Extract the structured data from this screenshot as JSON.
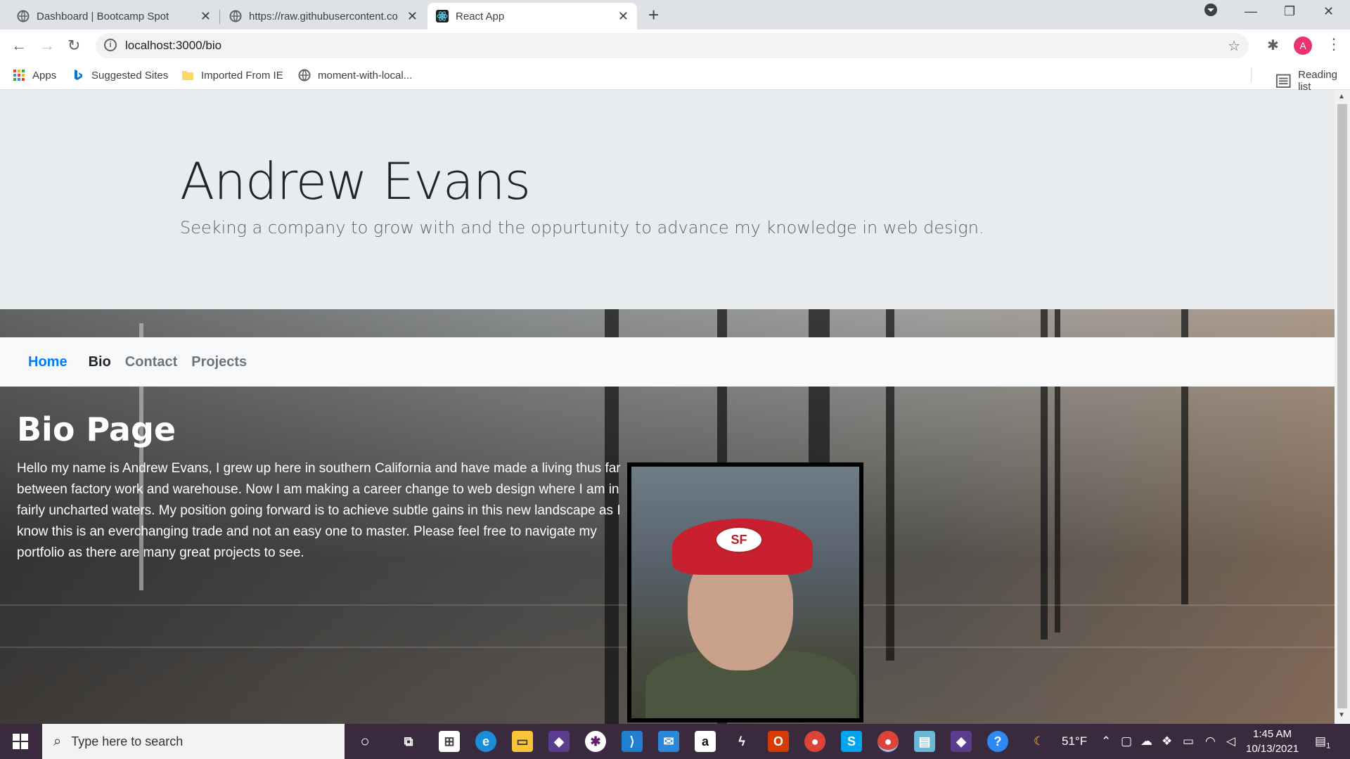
{
  "browser": {
    "tabs": [
      {
        "title": "Dashboard | Bootcamp Spot",
        "active": false
      },
      {
        "title": "https://raw.githubusercontent.co",
        "active": false
      },
      {
        "title": "React App",
        "active": true
      }
    ],
    "new_tab_label": "+",
    "url": "localhost:3000/bio",
    "bookmarks": [
      {
        "label": "Apps",
        "icon": "apps-grid-icon"
      },
      {
        "label": "Suggested Sites",
        "icon": "bing-icon"
      },
      {
        "label": "Imported From IE",
        "icon": "folder-icon"
      },
      {
        "label": "moment-with-local...",
        "icon": "globe-icon"
      }
    ],
    "reading_list": "Reading list",
    "avatar_letter": "A"
  },
  "jumbotron": {
    "name": "Andrew Evans",
    "tagline": "Seeking a company to grow with and the oppurtunity to advance my knowledge in web design."
  },
  "nav": {
    "links": [
      {
        "label": "Home",
        "color": "#007bff"
      },
      {
        "label": "Bio",
        "color": "#212529"
      },
      {
        "label": "Contact",
        "color": "#6c757d"
      },
      {
        "label": "Projects",
        "color": "#6c757d"
      }
    ]
  },
  "bio": {
    "title": "Bio Page",
    "text": "Hello my name is Andrew Evans, I grew up here in southern California and have made a living thus far between factory work and warehouse. Now I am making a career change to web design where I am in fairly uncharted waters. My position going forward is to achieve subtle gains in this new landscape as I know this is an everchanging trade and not an easy one to master. Please feel free to navigate my portfolio as there are many great projects to see."
  },
  "taskbar": {
    "search_placeholder": "Type here to search",
    "temperature": "51°F",
    "time": "1:45 AM",
    "date": "10/13/2021",
    "notifications": "1"
  }
}
